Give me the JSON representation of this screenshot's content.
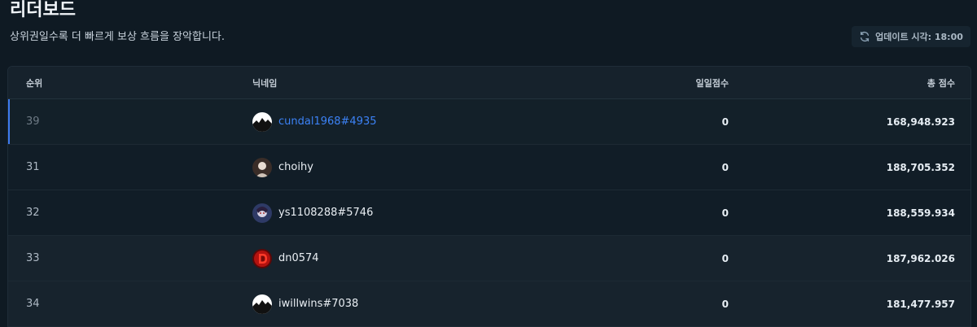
{
  "page": {
    "title": "리더보드",
    "subtitle": "상위권일수록 더 빠르게 보상 흐름을 장악합니다.",
    "update_label": "업데이트 시각: 18:00",
    "update_icon": "refresh-icon"
  },
  "table": {
    "headers": {
      "rank": "순위",
      "nickname": "닉네임",
      "daily": "일일점수",
      "total": "총 점수"
    },
    "rows": [
      {
        "rank": "39",
        "nickname": "cundal1968#4935",
        "daily": "0",
        "total": "168,948.923",
        "avatar": "mountain-avatar",
        "current_user": true
      },
      {
        "rank": "31",
        "nickname": "choihy",
        "daily": "0",
        "total": "188,705.352",
        "avatar": "person-avatar",
        "current_user": false
      },
      {
        "rank": "32",
        "nickname": "ys1108288#5746",
        "daily": "0",
        "total": "188,559.934",
        "avatar": "character-avatar",
        "current_user": false
      },
      {
        "rank": "33",
        "nickname": "dn0574",
        "daily": "0",
        "total": "187,962.026",
        "avatar": "red-logo-avatar",
        "current_user": false
      },
      {
        "rank": "34",
        "nickname": "iwillwins#7038",
        "daily": "0",
        "total": "181,477.957",
        "avatar": "mountain-avatar",
        "current_user": false
      }
    ]
  },
  "colors": {
    "highlight": "#3c82f6",
    "background": "#0f1a23"
  }
}
